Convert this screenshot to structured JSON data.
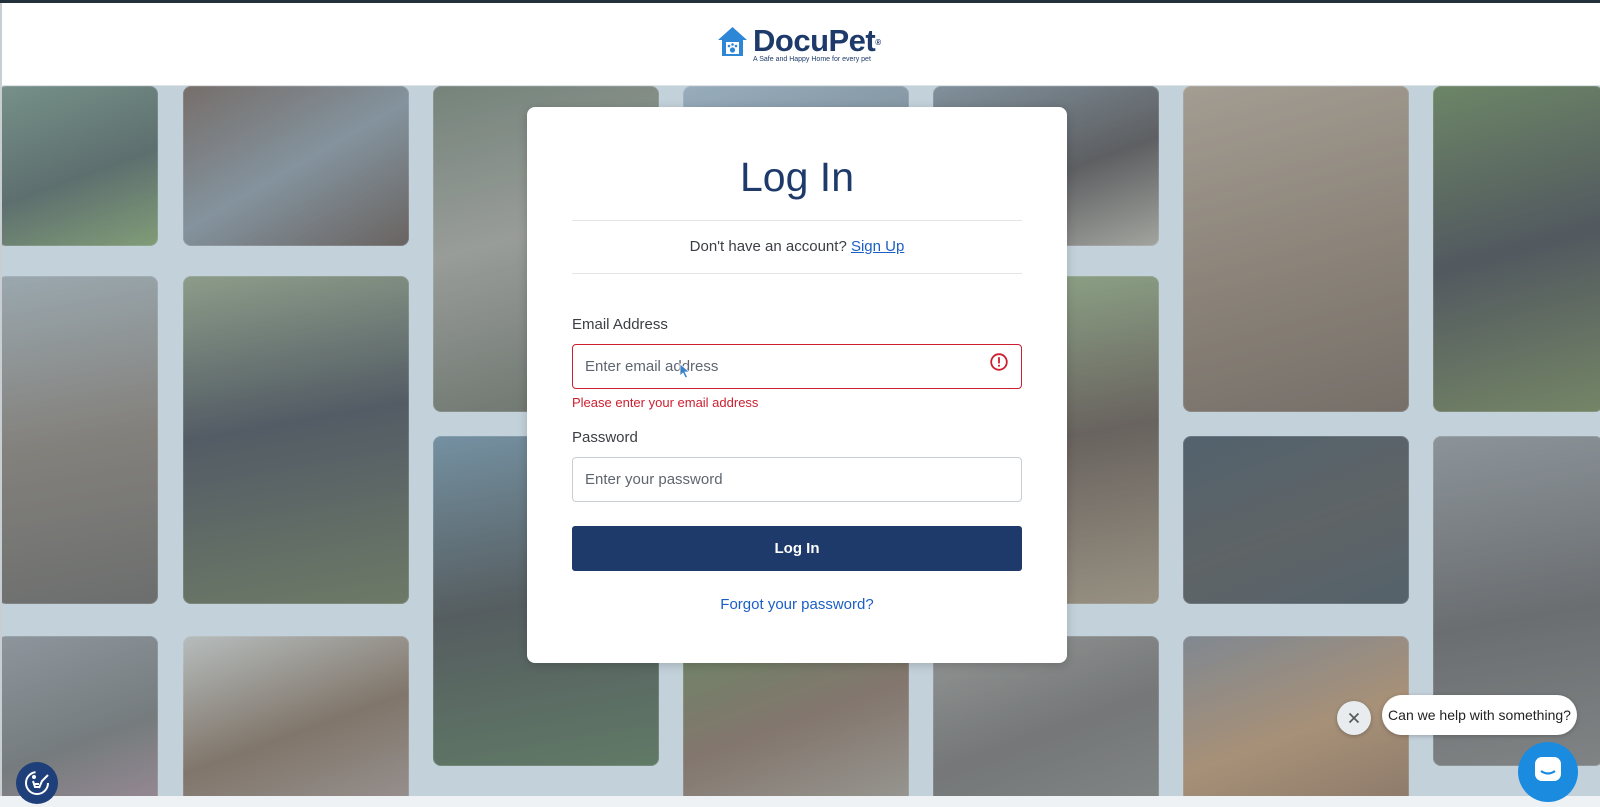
{
  "brand": {
    "name": "DocuPet",
    "trademark": "®",
    "tagline": "A Safe and Happy Home for every pet",
    "primary_color": "#1d3a6b",
    "logo_icon": "house-paw-icon"
  },
  "login": {
    "title": "Log In",
    "signup_prompt": "Don't have an account?",
    "signup_link": "Sign Up",
    "email": {
      "label": "Email Address",
      "placeholder": "Enter email address",
      "value": "",
      "error": "Please enter your email address",
      "error_icon": "alert-circle-icon"
    },
    "password": {
      "label": "Password",
      "placeholder": "Enter your password",
      "value": ""
    },
    "submit_label": "Log In",
    "forgot_label": "Forgot your password?",
    "link_color": "#1b5fc4",
    "error_color": "#cc1f2f"
  },
  "chat": {
    "prompt": "Can we help with something?",
    "close_icon": "close-icon",
    "launcher_icon": "chat-icon"
  },
  "accessibility": {
    "icon": "accessibility-icon"
  }
}
